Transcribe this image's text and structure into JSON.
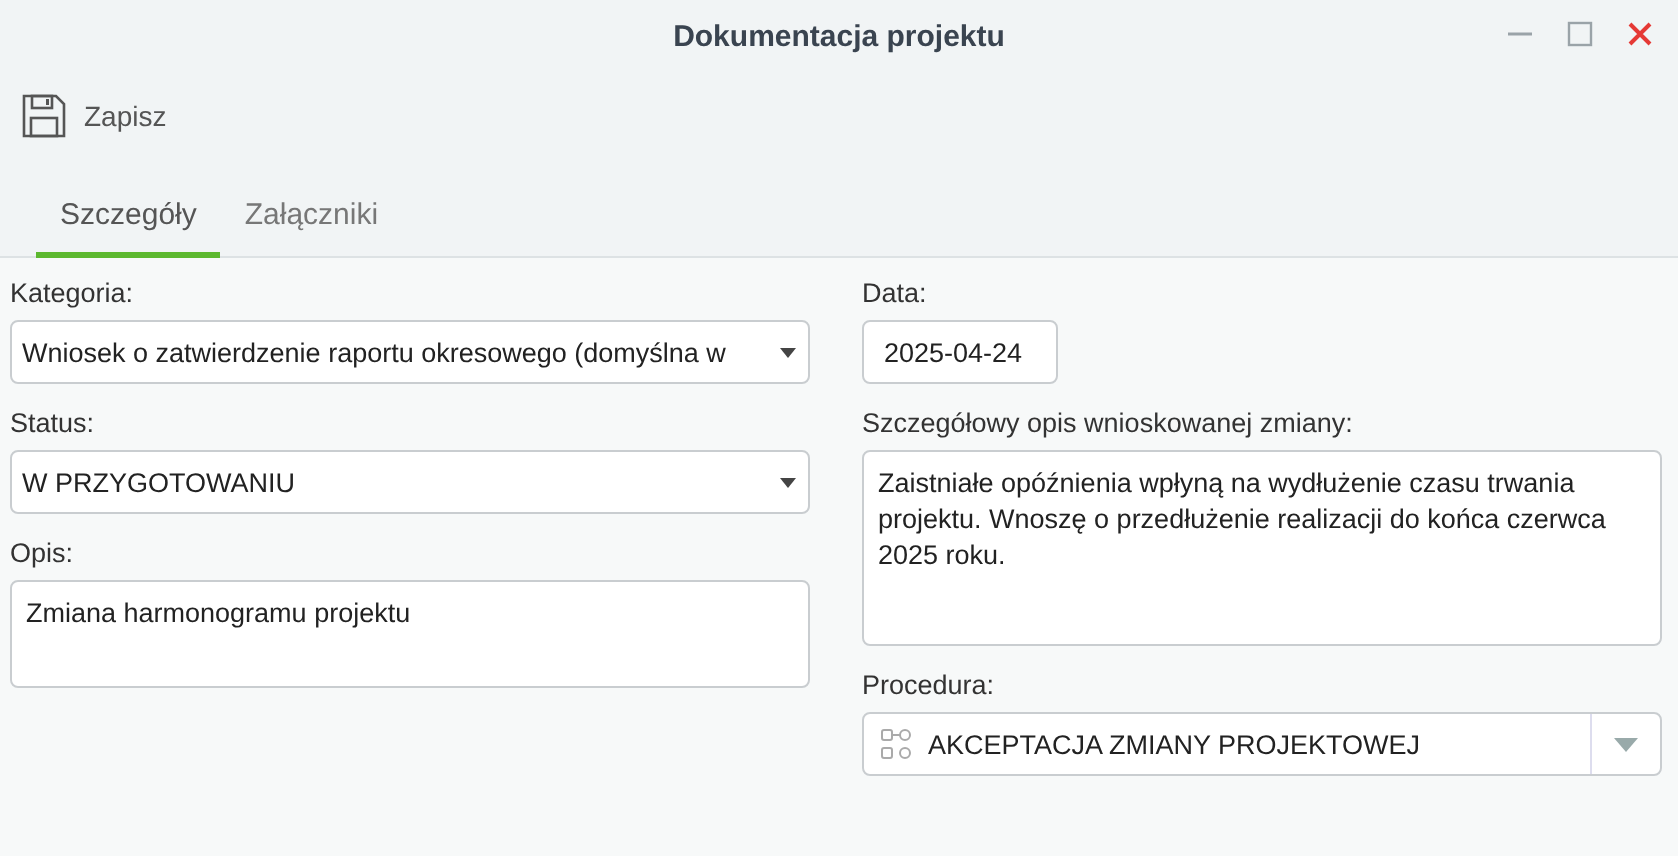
{
  "window": {
    "title": "Dokumentacja projektu"
  },
  "toolbar": {
    "save_label": "Zapisz"
  },
  "tabs": [
    {
      "label": "Szczegóły",
      "selected": true
    },
    {
      "label": "Załączniki",
      "selected": false
    }
  ],
  "left_fields": [
    {
      "kind": "select",
      "label": "Kategoria:",
      "value": "Wniosek o zatwierdzenie raportu okresowego (domyślna w"
    },
    {
      "kind": "select",
      "label": "Status:",
      "value": "W PRZYGOTOWANIU"
    },
    {
      "kind": "textarea",
      "label": "Opis:",
      "value": "Zmiana harmonogramu projektu"
    }
  ],
  "right_fields": [
    {
      "kind": "date",
      "label": "Data:",
      "value": "2025-04-24"
    },
    {
      "kind": "textarea_tall",
      "label": "Szczegółowy opis wnioskowanej zmiany:",
      "value": "Zaistniałe opóźnienia wpłyną na wydłużenie czasu trwania projektu. Wnoszę o przedłużenie realizacji do końca czerwca 2025 roku."
    },
    {
      "kind": "procedure",
      "label": "Procedura:",
      "value": "AKCEPTACJA ZMIANY PROJEKTOWEJ"
    }
  ]
}
